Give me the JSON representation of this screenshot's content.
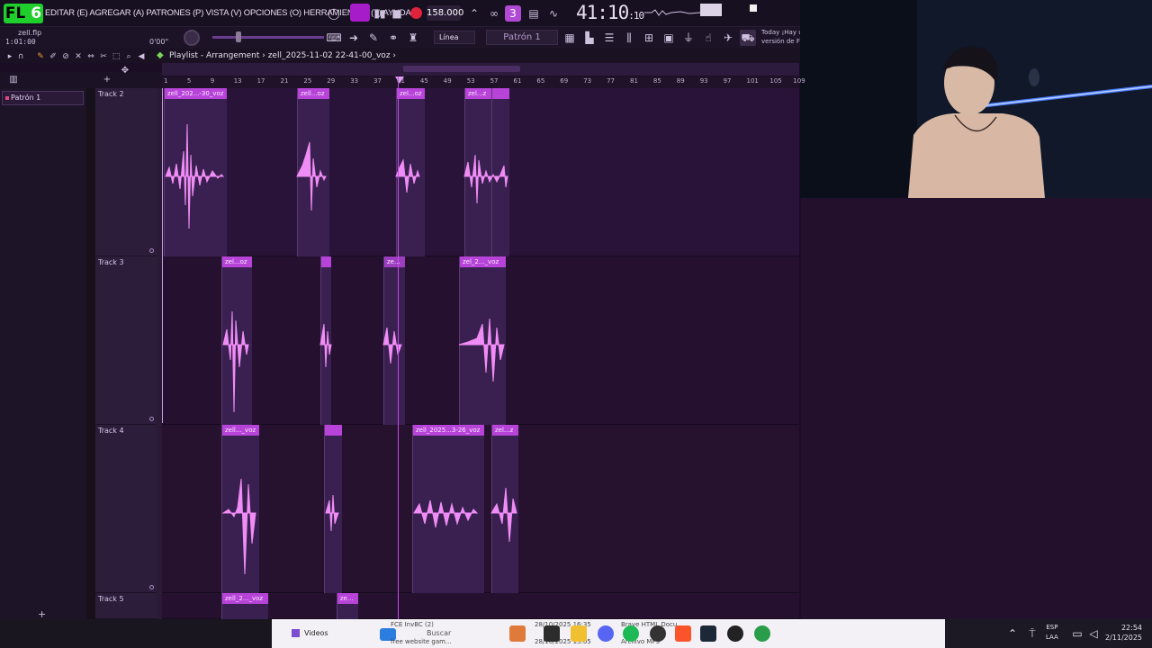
{
  "app": {
    "logo_text": "FL",
    "logo_version": "6",
    "menu_text": "EDITAR (E) AGREGAR (A) PATRONES (P) VISTA (V) OPCIONES (O) HERRAMIENTAS (T) AYUDA",
    "tempo": "158.000",
    "clock_main": "41:10",
    "clock_sub": ":10",
    "file_name": "zell.flp",
    "file_time": "1:01:00",
    "knob_time": "0'00\"",
    "snap_label": "Línea",
    "pattern_label": "Patrón 1",
    "hint_line1": "Today  ¡Hay u",
    "hint_line2": "versión de FL"
  },
  "playlist": {
    "title": "Playlist - Arrangement",
    "arrangement": "zell_2025-11-02 22-41-00_voz",
    "picker_item": "Patrón 1",
    "ruler_ticks": [
      "1",
      "5",
      "9",
      "13",
      "17",
      "21",
      "25",
      "29",
      "33",
      "37",
      "41",
      "45",
      "49",
      "53",
      "57",
      "61",
      "65",
      "69",
      "73",
      "77",
      "81",
      "85",
      "89",
      "93",
      "97",
      "101",
      "105",
      "109"
    ],
    "tracks": [
      {
        "name": "Track 2",
        "clips": [
          "zell_202...-30_voz",
          "zell...oz",
          "zel...oz",
          "zel...z",
          ""
        ]
      },
      {
        "name": "Track 3",
        "clips": [
          "zel...oz",
          "",
          "ze...",
          "zel_2..._voz"
        ]
      },
      {
        "name": "Track 4",
        "clips": [
          "zell..._voz",
          "",
          "zell_2025...3-26_voz",
          "zel...z"
        ]
      },
      {
        "name": "Track 5",
        "clips": [
          "zell_2..._voz",
          "ze..."
        ]
      }
    ]
  },
  "taskbar": {
    "videos_label": "Videos",
    "search_label": "Buscar",
    "item_fce": "FCE InvBC (2)",
    "item_brave": "Brave HTML Docu",
    "item_date1": "28/10/2025 16:35",
    "item_date2": "28/10/2025 13:05",
    "item_archivo": "Archivo MP3",
    "item_free": "free website gam...",
    "lang_top": "ESP",
    "lang_bottom": "LAA",
    "time": "22:54",
    "date": "2/11/2025"
  },
  "colors": {
    "clip_header": "#b743d9",
    "waveform": "#f08cf5",
    "playhead": "#c14be8",
    "logo": "#1fcf2c"
  }
}
